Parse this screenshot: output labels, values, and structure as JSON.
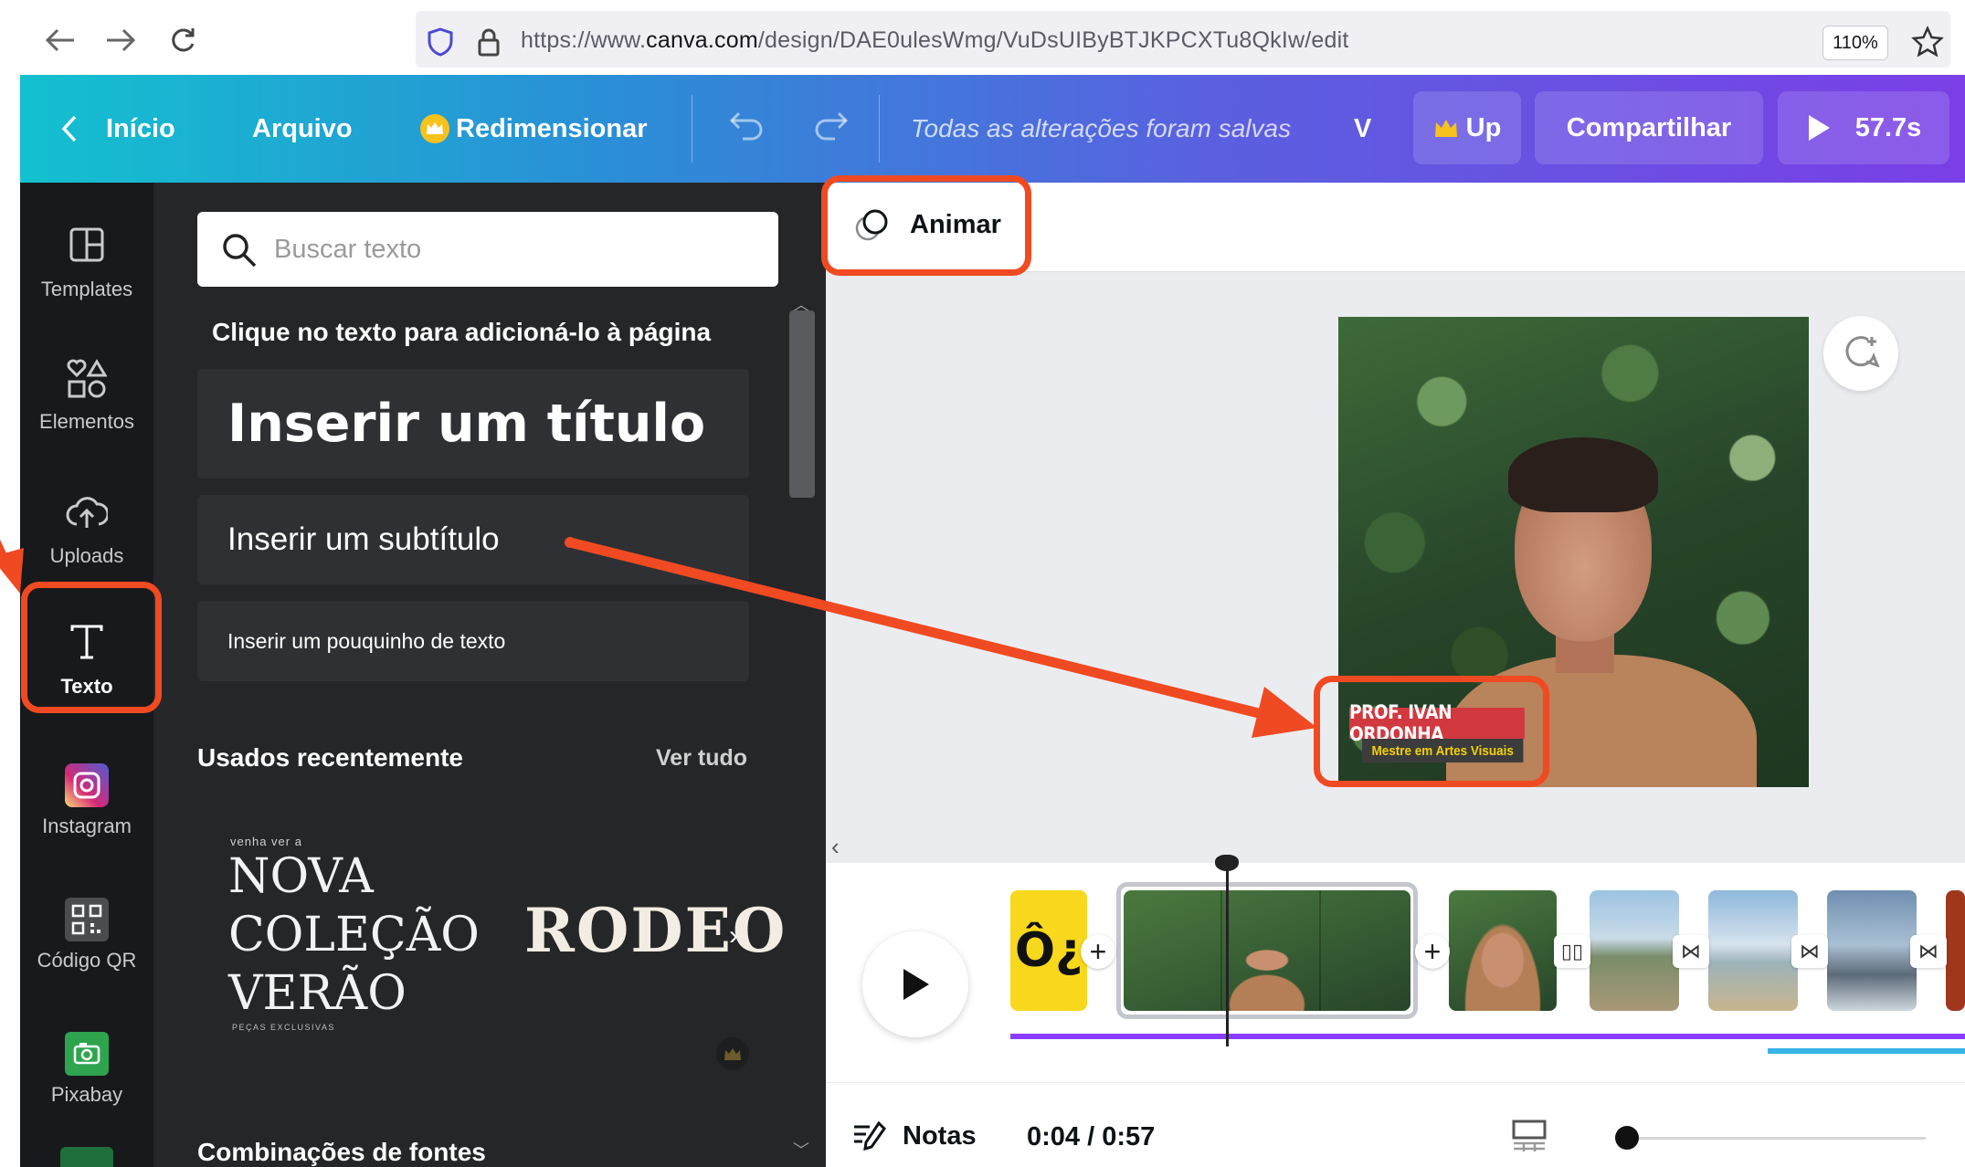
{
  "browser": {
    "url_prefix": "https://www.",
    "url_domain": "canva.com",
    "url_path": "/design/DAE0ulesWmg/VuDsUIByBTJKPCXTu8QkIw/edit",
    "zoom": "110%"
  },
  "header": {
    "home": "Início",
    "file": "Arquivo",
    "resize": "Redimensionar",
    "saved_status": "Todas as alterações foram salvas",
    "truncated": "V",
    "upgrade": "Up",
    "share": "Compartilhar",
    "duration": "57.7s"
  },
  "rail": [
    {
      "label": "Templates",
      "icon": "templates-icon"
    },
    {
      "label": "Elementos",
      "icon": "elements-icon"
    },
    {
      "label": "Uploads",
      "icon": "upload-icon"
    },
    {
      "label": "Texto",
      "icon": "text-icon",
      "active": true
    },
    {
      "label": "Instagram",
      "icon": "instagram-icon"
    },
    {
      "label": "Código QR",
      "icon": "qr-code-icon"
    },
    {
      "label": "Pixabay",
      "icon": "pixabay-icon"
    }
  ],
  "panel": {
    "search_placeholder": "Buscar texto",
    "hint": "Clique no texto para adicioná-lo à página",
    "heading_btn": "Inserir um título",
    "subheading_btn": "Inserir um subtítulo",
    "body_btn": "Inserir um pouquinho de texto",
    "recent_title": "Usados recentemente",
    "see_all": "Ver tudo",
    "sample1_kicker": "venha ver a",
    "sample1_line1": "NOVA",
    "sample1_line2": "COLEÇÃO",
    "sample1_line3": "VERÃO",
    "sample1_footer": "PEÇAS EXCLUSIVAS",
    "sample2": "RODEO",
    "combos_title": "Combinações de fontes"
  },
  "editor": {
    "animate": "Animar",
    "lower_third_name": "PROF. IVAN ORDONHA",
    "lower_third_role": "Mestre em Artes Visuais"
  },
  "timeline": {
    "intro_clip_text": "Ô¿",
    "time": "0:04 / 0:57",
    "notes": "Notas"
  },
  "colors": {
    "annotation": "#f04a22",
    "progress": "#8b3dff",
    "audio": "#36b4e6"
  }
}
